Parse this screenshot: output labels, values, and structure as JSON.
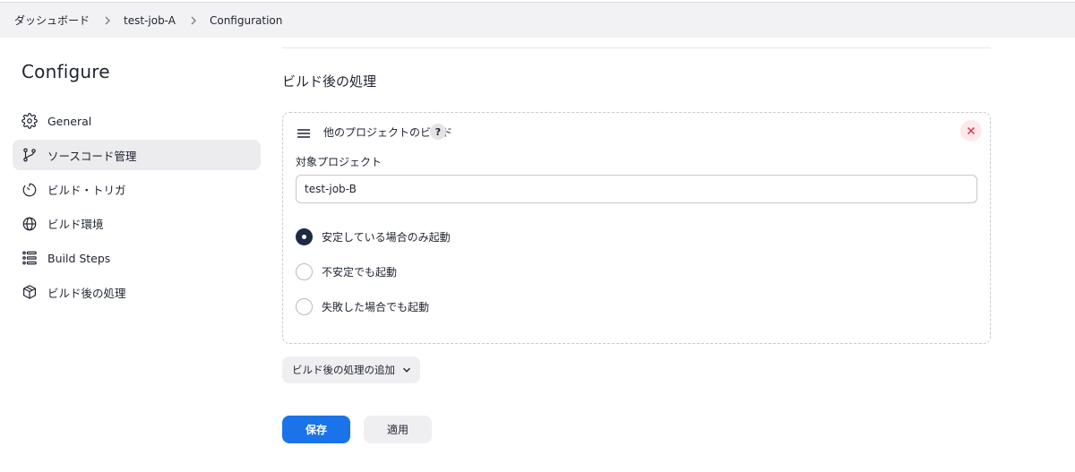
{
  "breadcrumb": {
    "items": [
      "ダッシュボード",
      "test-job-A",
      "Configuration"
    ]
  },
  "sidebar": {
    "title": "Configure",
    "items": [
      {
        "label": "General",
        "icon": "gear-icon",
        "active": false
      },
      {
        "label": "ソースコード管理",
        "icon": "branch-icon",
        "active": true
      },
      {
        "label": "ビルド・トリガ",
        "icon": "timer-icon",
        "active": false
      },
      {
        "label": "ビルド環境",
        "icon": "globe-icon",
        "active": false
      },
      {
        "label": "Build Steps",
        "icon": "list-icon",
        "active": false
      },
      {
        "label": "ビルド後の処理",
        "icon": "package-icon",
        "active": false
      }
    ]
  },
  "main": {
    "section_title": "ビルド後の処理",
    "card": {
      "title": "他のプロジェクトのビルド",
      "help_label": "?",
      "field_label": "対象プロジェクト",
      "project_value": "test-job-B",
      "radio_options": [
        {
          "label": "安定している場合のみ起動",
          "checked": true
        },
        {
          "label": "不安定でも起動",
          "checked": false
        },
        {
          "label": "失敗した場合でも起動",
          "checked": false
        }
      ]
    },
    "add_button_label": "ビルド後の処理の追加",
    "save_label": "保存",
    "apply_label": "適用"
  },
  "colors": {
    "primary": "#1a73e8",
    "radio_checked": "#1e2a44",
    "close_icon": "#d93848",
    "active_item_bg": "#ececee"
  }
}
